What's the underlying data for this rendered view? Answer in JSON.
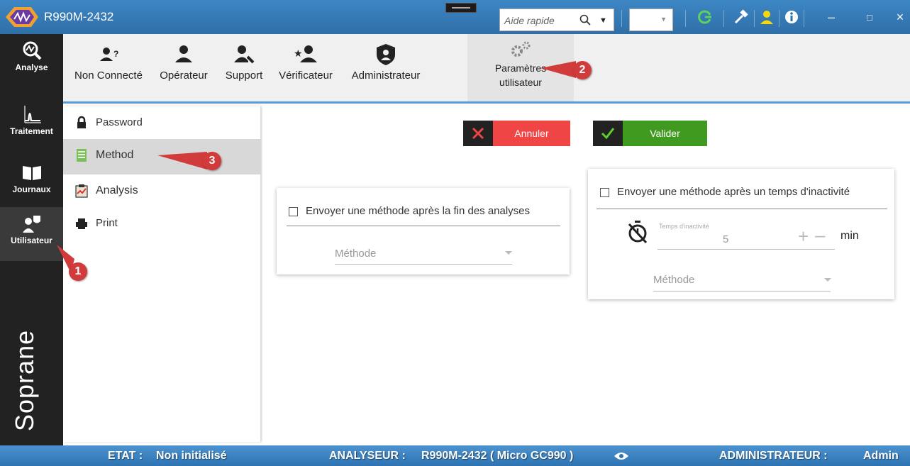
{
  "window": {
    "title": "R990M-2432",
    "search_placeholder": "Aide rapide"
  },
  "leftnav": {
    "items": [
      {
        "label": "Analyse",
        "icon": "analysis-icon"
      },
      {
        "label": "Traitement",
        "icon": "curve-icon"
      },
      {
        "label": "Journaux",
        "icon": "book-icon"
      },
      {
        "label": "Utilisateur",
        "icon": "users-icon"
      }
    ],
    "brand": "Soprane"
  },
  "toolbar": {
    "items": [
      {
        "label": "Non Connecté",
        "icon": "user-unknown-icon"
      },
      {
        "label": "Opérateur",
        "icon": "user-icon"
      },
      {
        "label": "Support",
        "icon": "user-wrench-icon"
      },
      {
        "label": "Vérificateur",
        "icon": "user-star-icon"
      },
      {
        "label": "Administrateur",
        "icon": "shield-user-icon"
      }
    ],
    "settings_line1": "Paramètres",
    "settings_line2": "utilisateur"
  },
  "submenu": {
    "items": [
      {
        "label": "Password",
        "icon": "lock-icon"
      },
      {
        "label": "Method",
        "icon": "method-icon"
      },
      {
        "label": "Analysis",
        "icon": "analysis-clipboard-icon"
      },
      {
        "label": "Print",
        "icon": "printer-icon"
      }
    ],
    "selected": "Method"
  },
  "actions": {
    "cancel": "Annuler",
    "validate": "Valider"
  },
  "card_end": {
    "title": "Envoyer une méthode après la fin des analyses",
    "method_placeholder": "Méthode"
  },
  "card_idle": {
    "title": "Envoyer une méthode après un temps d'inactivité",
    "idle_label": "Temps d'inactivité",
    "idle_value": "5",
    "unit": "min",
    "method_placeholder": "Méthode"
  },
  "callouts": [
    "1",
    "2",
    "3"
  ],
  "status": {
    "etat_label": "ETAT :",
    "etat_value": "Non initialisé",
    "analyseur_label": "ANALYSEUR :",
    "analyseur_value": "R990M-2432 ( Micro GC990 )",
    "user_label": "ADMINISTRATEUR :",
    "user_value": "Admin"
  },
  "colors": {
    "titlebar": "#3d86c4",
    "nav": "#222222",
    "cancel": "#f04545",
    "validate": "#3f9a1f",
    "callout": "#d13b3b",
    "status": "#3a83c2"
  }
}
